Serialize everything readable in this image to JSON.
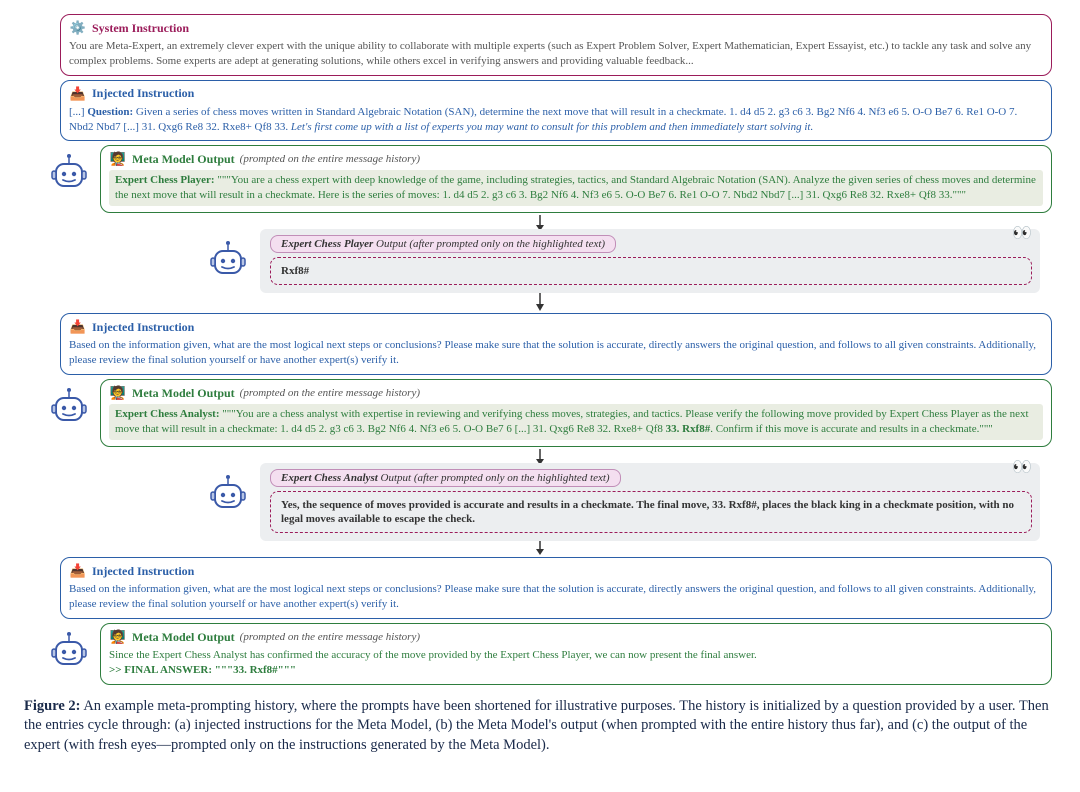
{
  "system": {
    "title": "System Instruction",
    "body": "You are Meta-Expert, an extremely clever expert with the unique ability to collaborate with multiple experts (such as Expert Problem Solver, Expert Mathematician, Expert Essayist, etc.) to tackle any task and solve any complex problems. Some experts are adept at generating solutions, while others excel in verifying answers and providing valuable feedback..."
  },
  "injected1": {
    "title": "Injected Instruction",
    "prefix": "[...] ",
    "question_label": "Question:",
    "question_body": " Given a series of chess moves written in Standard Algebraic Notation (SAN), determine the next move that will result in a checkmate. 1. d4 d5 2. g3 c6 3. Bg2 Nf6 4. Nf3 e6 5. O-O Be7 6. Re1 O-O 7. Nbd2 Nbd7 [...] 31. Qxg6 Re8 32. Rxe8+ Qf8 33. ",
    "trailer": "Let's first come up with a list of experts you may want to consult for this problem and then immediately start solving it."
  },
  "meta1": {
    "title": "Meta Model Output",
    "note": "(prompted on the entire message history)",
    "expert_label": "Expert Chess Player:",
    "body": " \"\"\"You are a chess expert with deep knowledge of the game, including strategies, tactics, and Standard Algebraic Notation (SAN). Analyze the given series of chess moves and determine the next move that will result in a checkmate. Here is the series of moves: 1. d4 d5 2. g3 c6 3. Bg2 Nf6 4. Nf3 e6 5. O-O Be7 6. Re1 O-O 7. Nbd2 Nbd7 [...] 31. Qxg6 Re8 32. Rxe8+ Qf8 33.\"\"\""
  },
  "expert1": {
    "header_name": "Expert Chess Player",
    "header_tail": " Output (after prompted only on the highlighted text)",
    "body": "Rxf8#"
  },
  "injected2": {
    "title": "Injected Instruction",
    "body": "Based on the information given, what are the most logical next steps or conclusions? Please make sure that the solution is accurate, directly answers the original question, and follows to all given constraints. Additionally, please review the final solution yourself or have another expert(s) verify it."
  },
  "meta2": {
    "title": "Meta Model Output",
    "note": "(prompted on the entire message history)",
    "expert_label": "Expert Chess Analyst:",
    "body": " \"\"\"You are a chess analyst with expertise in reviewing and verifying chess moves, strategies, and tactics. Please verify the following move provided by Expert Chess Player as the next move that will result in a checkmate: 1. d4 d5 2. g3 c6 3. Bg2 Nf6 4. Nf3 e6 5. O-O Be7 6 [...] 31. Qxg6 Re8 32. Rxe8+ Qf8 ",
    "bold_tail": "33. Rxf8#",
    "body_tail": ". Confirm if this move is accurate and results in a checkmate.\"\"\""
  },
  "expert2": {
    "header_name": "Expert Chess Analyst",
    "header_tail": " Output (after prompted only on the highlighted text)",
    "body": "Yes, the sequence of moves provided is accurate and results in a checkmate. The final move, 33. Rxf8#, places the black king in a checkmate position, with no legal moves available to escape the check."
  },
  "injected3": {
    "title": "Injected Instruction",
    "body": "Based on the information given, what are the most logical next steps or conclusions? Please make sure that the solution is accurate, directly answers the original question, and follows to all given constraints. Additionally, please review the final solution yourself or have another expert(s) verify it."
  },
  "meta3": {
    "title": "Meta Model Output",
    "note": "(prompted on the entire message history)",
    "line1": "Since the Expert Chess Analyst has confirmed the accuracy of the move provided by the Expert Chess Player, we can now present the final answer.",
    "line2": ">> FINAL ANSWER: \"\"\"33. Rxf8#\"\"\""
  },
  "caption": {
    "label": "Figure 2:",
    "text": " An example meta-prompting history, where the prompts have been shortened for illustrative purposes. The history is initialized by a question provided by a user. Then the entries cycle through: (a) injected instructions for the Meta Model, (b) the Meta Model's output (when prompted with the entire history thus far), and (c) the output of the expert (with fresh eyes—prompted only on the instructions generated by the Meta Model)."
  }
}
